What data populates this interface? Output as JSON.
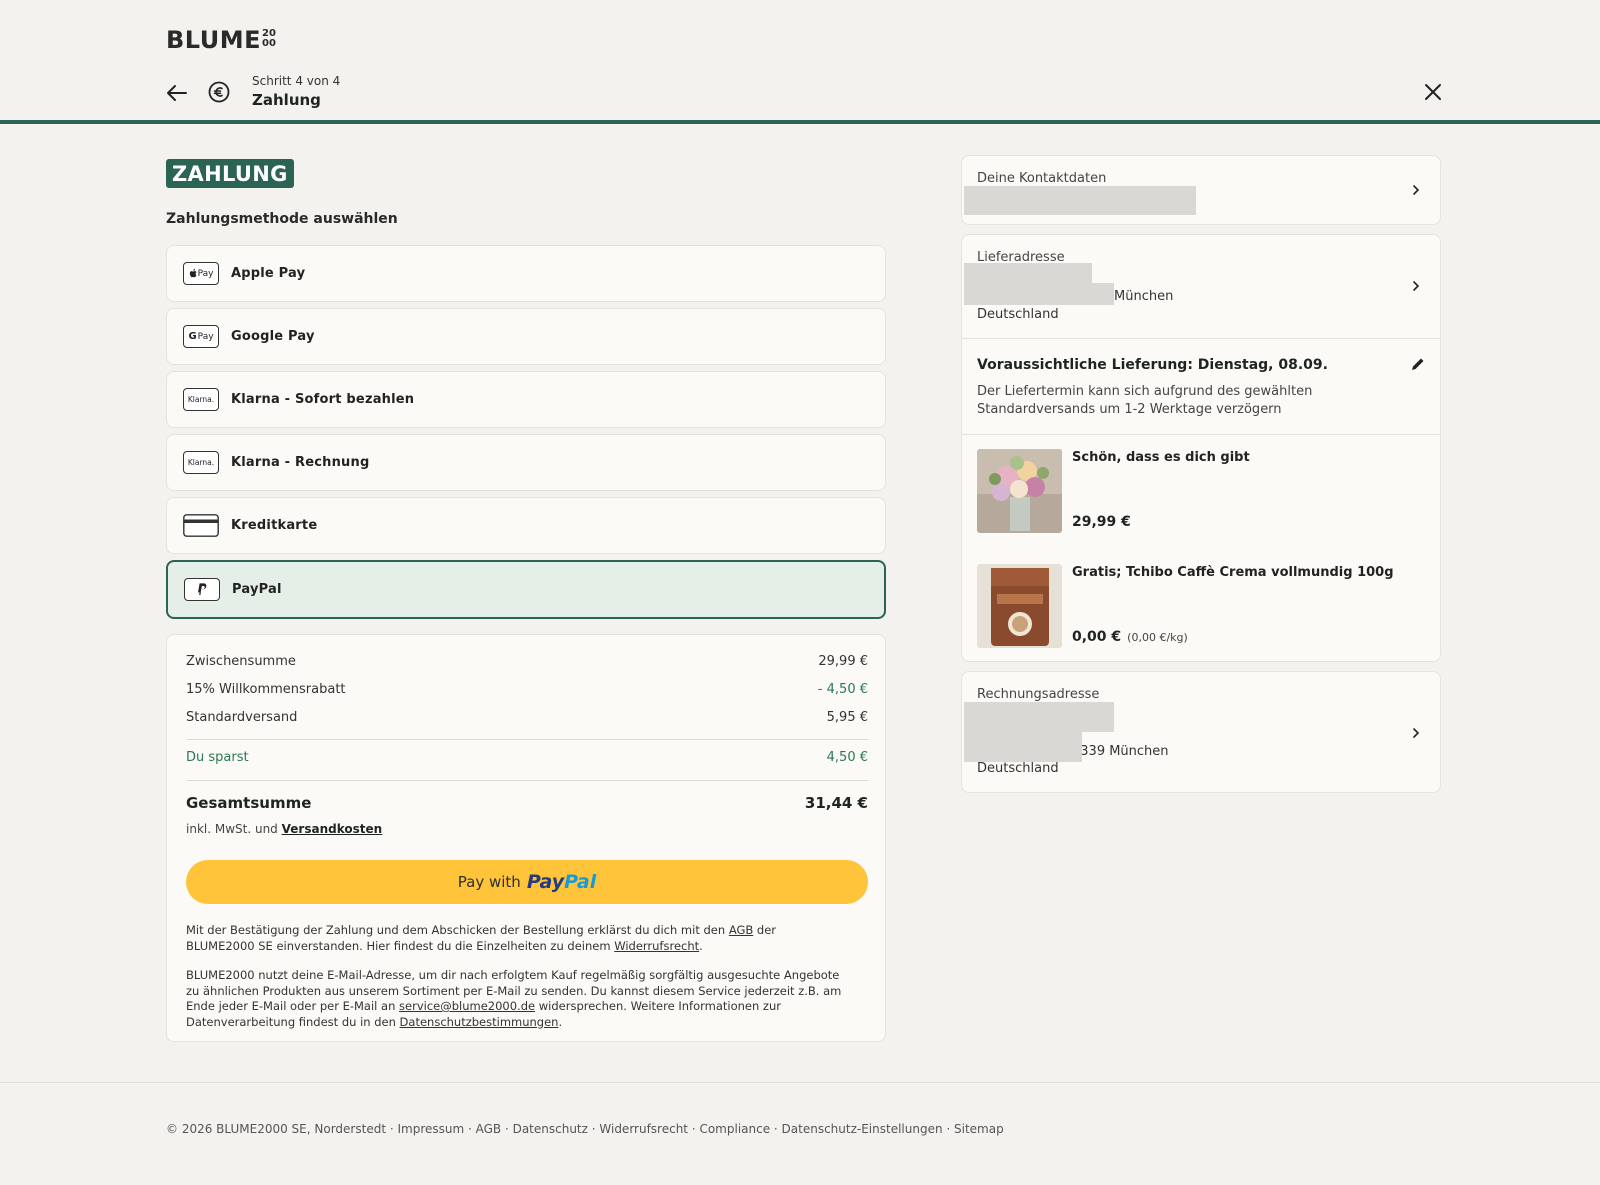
{
  "header": {
    "logo_text": "BLUME",
    "logo_sup": "2000",
    "step_label": "Schritt 4 von 4",
    "step_title": "Zahlung"
  },
  "payment": {
    "badge": "ZAHLUNG",
    "subtitle": "Zahlungsmethode auswählen",
    "methods": [
      {
        "label": "Apple Pay",
        "icon": "apple-pay-icon",
        "selected": false
      },
      {
        "label": "Google Pay",
        "icon": "google-pay-icon",
        "selected": false
      },
      {
        "label": "Klarna - Sofort bezahlen",
        "icon": "klarna-icon",
        "selected": false
      },
      {
        "label": "Klarna - Rechnung",
        "icon": "klarna-icon",
        "selected": false
      },
      {
        "label": "Kreditkarte",
        "icon": "credit-card-icon",
        "selected": false
      },
      {
        "label": "PayPal",
        "icon": "paypal-icon",
        "selected": true
      }
    ],
    "icon_text": {
      "apple": "Pay",
      "google": "Pay",
      "klarna": "Klarna."
    }
  },
  "summary": {
    "subtotal_label": "Zwischensumme",
    "subtotal_value": "29,99 €",
    "discount_label": "15% Willkommensrabatt",
    "discount_value": "- 4,50 €",
    "shipping_label": "Standardversand",
    "shipping_value": "5,95 €",
    "savings_label": "Du sparst",
    "savings_value": "4,50 €",
    "total_label": "Gesamtsumme",
    "total_value": "31,44 €",
    "incl_text": "inkl. MwSt. und",
    "incl_link": "Versandkosten",
    "paypal_with": "Pay with",
    "paypal_logo_1": "Pay",
    "paypal_logo_2": "Pal",
    "legal1_a": "Mit der Bestätigung der Zahlung und dem Abschicken der Bestellung erklärst du dich mit den ",
    "legal1_link1": "AGB",
    "legal1_b": " der BLUME2000 SE einverstanden. Hier findest du die Einzelheiten zu deinem ",
    "legal1_link2": "Widerrufsrecht",
    "legal1_c": ".",
    "legal2_a": "BLUME2000 nutzt deine E-Mail-Adresse, um dir nach erfolgtem Kauf regelmäßig sorgfältig ausgesuchte Angebote zu ähnlichen Produkten aus unserem Sortiment per E-Mail zu senden. Du kannst diesem Service jederzeit z.B. am Ende jeder E-Mail oder per E-Mail an ",
    "legal2_link1": "service@blume2000.de",
    "legal2_b": " widersprechen. Weitere Informationen zur Datenverarbeitung findest du in den ",
    "legal2_link2": "Datenschutzbestimmungen",
    "legal2_c": "."
  },
  "sidebar": {
    "contact_label": "Deine Kontaktdaten",
    "delivery_label": "Lieferadresse",
    "delivery_city": "München",
    "delivery_country": "Deutschland",
    "delivery_date": "Voraussichtliche Lieferung: Dienstag, 08.09.",
    "delivery_note": "Der Liefertermin kann sich aufgrund des gewählten Standardversands um 1-2 Werktage verzögern",
    "items": [
      {
        "name": "Schön, dass es dich gibt",
        "price": "29,99 €",
        "unit": ""
      },
      {
        "name": "Gratis; Tchibo Caffè Crema vollmundig 100g",
        "price": "0,00 €",
        "unit": "(0,00 €/kg)"
      }
    ],
    "billing_label": "Rechnungsadresse",
    "billing_city": "80339 München",
    "billing_city_visible": "0339 München",
    "billing_country": "Deutschland"
  },
  "footer": {
    "text": "© 2026 BLUME2000 SE, Norderstedt · Impressum · AGB · Datenschutz · Widerrufsrecht · Compliance · Datenschutz-Einstellungen · Sitemap"
  },
  "colors": {
    "brand": "#2b6354",
    "paypal_yellow": "#ffc439",
    "savings_green": "#2b7a4f",
    "background": "#f3f2ee"
  }
}
